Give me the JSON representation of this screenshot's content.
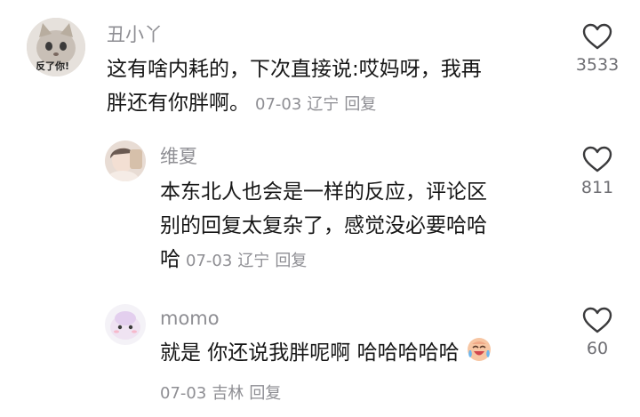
{
  "comments": [
    {
      "user": "丑小丫",
      "avatar_caption": "反了你!",
      "text_line1": "这有啥内耗的，下次直接说:哎妈呀，我再",
      "text_line2": "胖还有你胖啊。",
      "date": "07-03",
      "location": "辽宁",
      "reply_label": "回复",
      "likes": "3533"
    },
    {
      "user": "维夏",
      "text_line1": "本东北人也会是一样的反应，评论区",
      "text_line2": "别的回复太复杂了，感觉没必要哈哈",
      "text_line3": "哈",
      "date": "07-03",
      "location": "辽宁",
      "reply_label": "回复",
      "likes": "811"
    },
    {
      "user": "momo",
      "text": "就是 你还说我胖呢啊 哈哈哈哈哈",
      "emoji": "crying-laughing-emoji",
      "date": "07-03",
      "location": "吉林",
      "reply_label": "回复",
      "likes": "60"
    }
  ],
  "colors": {
    "text": "#161616",
    "muted": "#8e8e93",
    "like_icon": "#3a3a3c"
  }
}
